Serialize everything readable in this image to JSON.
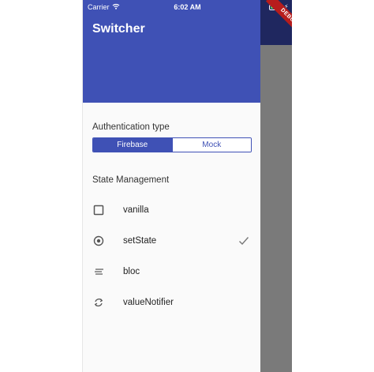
{
  "status_bar": {
    "carrier": "Carrier",
    "time": "6:02 AM",
    "battery_color": "#4cd964"
  },
  "debug_banner": "DEBUG",
  "drawer": {
    "title": "Switcher",
    "header_color": "#3f51b5",
    "auth": {
      "label": "Authentication type",
      "options": [
        "Firebase",
        "Mock"
      ],
      "selected": "Firebase"
    },
    "state": {
      "label": "State Management",
      "items": [
        {
          "label": "vanilla",
          "icon": "checkbox-outline-icon",
          "selected": false
        },
        {
          "label": "setState",
          "icon": "radio-button-icon",
          "selected": true
        },
        {
          "label": "bloc",
          "icon": "sort-lines-icon",
          "selected": false
        },
        {
          "label": "valueNotifier",
          "icon": "sync-arrows-icon",
          "selected": false
        }
      ],
      "selected_indicator": "checkmark-icon"
    }
  },
  "colors": {
    "accent": "#3f51b5",
    "scrim": "#7a7a7a",
    "app_bar_dim": "#1f275f"
  }
}
